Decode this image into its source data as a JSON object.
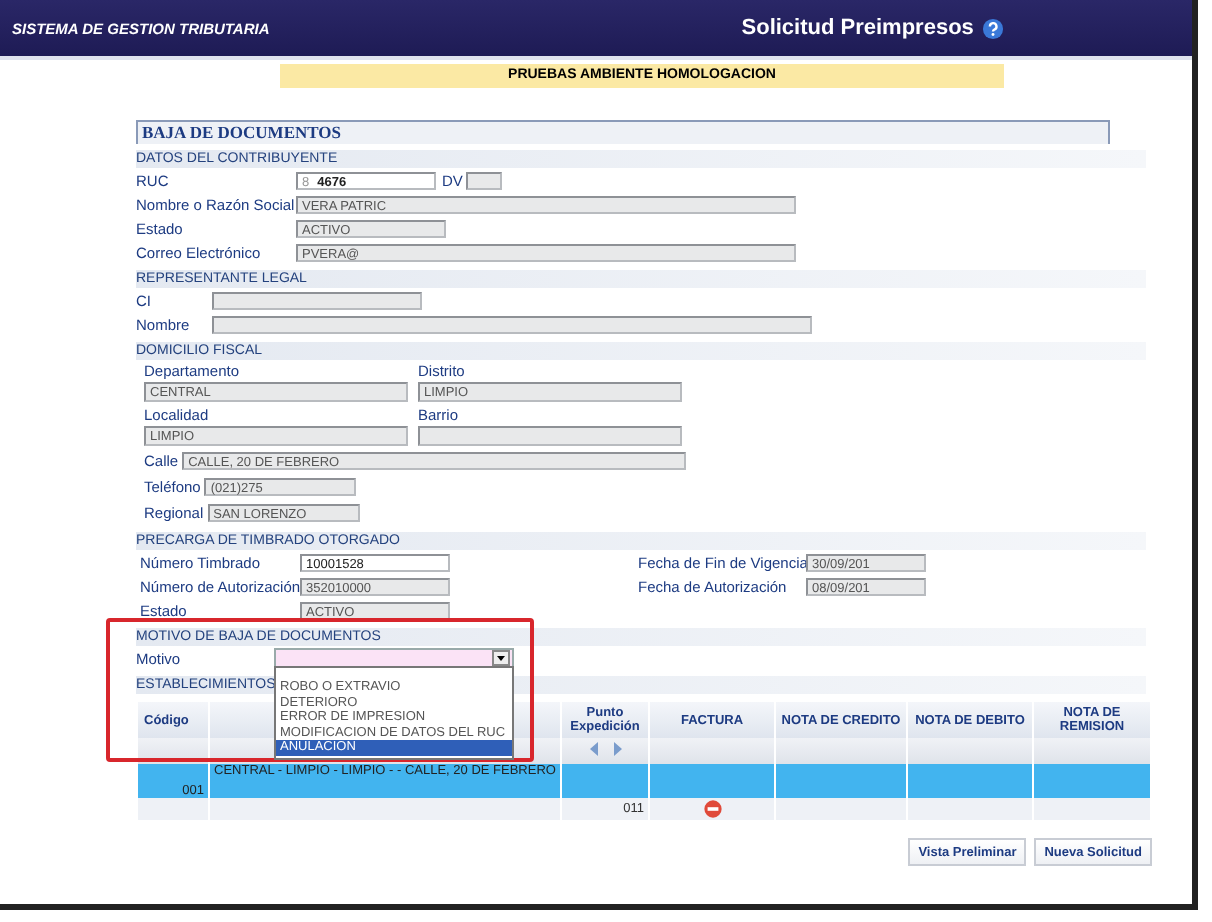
{
  "header": {
    "system": "SISTEMA DE GESTION TRIBUTARIA",
    "title": "Solicitud Preimpresos"
  },
  "banner": "PRUEBAS AMBIENTE HOMOLOGACION",
  "form_title": "BAJA DE DOCUMENTOS",
  "contribuyente": {
    "heading": "DATOS DEL CONTRIBUYENTE",
    "ruc": {
      "label": "RUC",
      "prefix": "8",
      "value": "4676"
    },
    "dv": {
      "label": "DV"
    },
    "fields": [
      {
        "label": "Nombre o Razón Social",
        "value": "VERA PATRIC",
        "kind": "wide"
      },
      {
        "label": "Estado",
        "value": "ACTIVO",
        "kind": "short"
      },
      {
        "label": "Correo Electrónico",
        "value": "PVERA@",
        "kind": "wide"
      }
    ]
  },
  "representante": {
    "heading": "REPRESENTANTE LEGAL",
    "fields": [
      {
        "label": "CI",
        "kind": "short"
      },
      {
        "label": "Nombre",
        "kind": "wide"
      }
    ]
  },
  "domicilio": {
    "heading": "DOMICILIO FISCAL",
    "grid": [
      {
        "label": "Departamento",
        "value": "CENTRAL"
      },
      {
        "label": "Distrito",
        "value": "LIMPIO"
      },
      {
        "label": "Localidad",
        "value": "LIMPIO"
      },
      {
        "label": "Barrio"
      }
    ],
    "calle": {
      "label": "Calle",
      "value": "CALLE, 20 DE FEBRERO"
    },
    "telefono": {
      "label": "Teléfono",
      "value": "(021)275"
    },
    "regional": {
      "label": "Regional",
      "value": "SAN LORENZO"
    }
  },
  "timbrado": {
    "heading": "PRECARGA DE TIMBRADO OTORGADO",
    "left": [
      {
        "label": "Número Timbrado",
        "value": "10001528",
        "disabled": false
      },
      {
        "label": "Número de Autorización",
        "value": "352010000",
        "disabled": true
      },
      {
        "label": "Estado",
        "value": "ACTIVO",
        "disabled": true
      }
    ],
    "right": [
      {
        "label": "Fecha de Fin de Vigencia",
        "value": "30/09/201",
        "disabled": true
      },
      {
        "label": "Fecha de Autorización",
        "value": "08/09/201",
        "disabled": true
      }
    ]
  },
  "motivo": {
    "heading": "MOTIVO DE BAJA DE DOCUMENTOS",
    "label": "Motivo",
    "open": true,
    "options": [
      {
        "label": "ROBO O EXTRAVIO",
        "selected": false
      },
      {
        "label": "DETERIORO",
        "selected": false
      },
      {
        "label": "ERROR DE IMPRESION",
        "selected": false
      },
      {
        "label": "MODIFICACION DE DATOS DEL RUC",
        "selected": false
      },
      {
        "label": "ANULACION",
        "selected": true
      }
    ]
  },
  "establecimientos": {
    "heading": "ESTABLECIMIENTOS",
    "columns": [
      "Código",
      "Punto Expedición",
      "FACTURA",
      "NOTA DE CREDITO",
      "NOTA DE DEBITO",
      "NOTA DE REMISION"
    ],
    "rows": [
      {
        "codigo": "001",
        "descripcion": "CENTRAL - LIMPIO - LIMPIO - - CALLE, 20 DE FEBRERO",
        "selected": true,
        "puntos": [
          {
            "punto": "011",
            "factura_blocked": true
          }
        ]
      }
    ]
  },
  "buttons": [
    "Vista Preliminar",
    "Nueva Solicitud"
  ]
}
